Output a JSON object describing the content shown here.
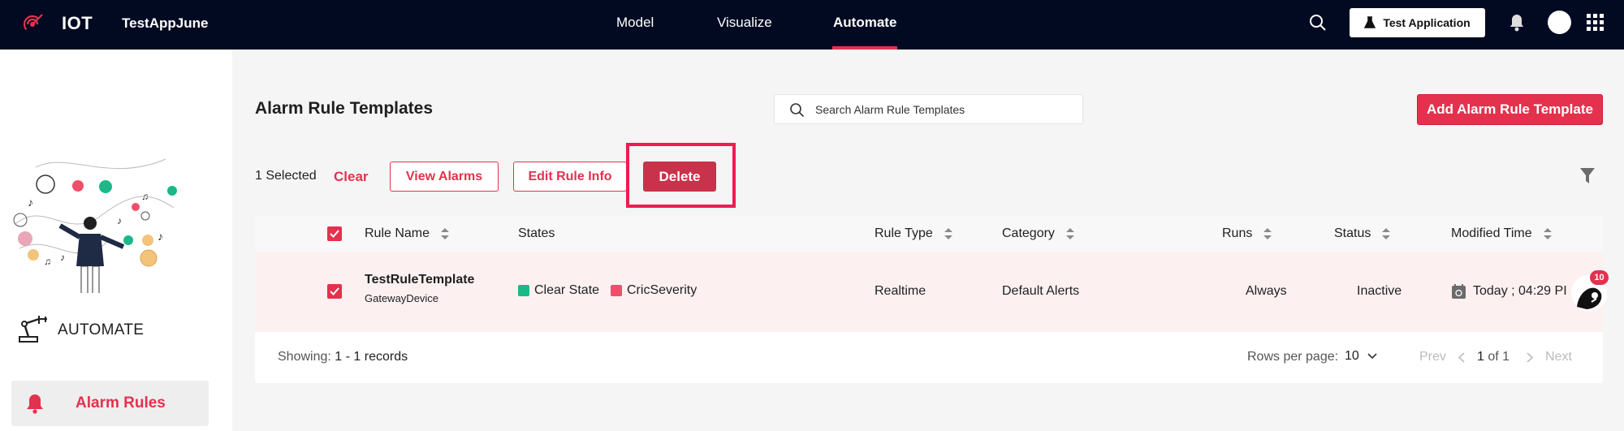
{
  "header": {
    "brand": "IOT",
    "app_name": "TestAppJune",
    "nav": [
      "Model",
      "Visualize",
      "Automate"
    ],
    "active_nav": "Automate",
    "app_button": "Test Application"
  },
  "sidebar": {
    "section_title": "AUTOMATE",
    "items": [
      {
        "label": "Alarm Rules"
      }
    ]
  },
  "main": {
    "title": "Alarm Rule Templates",
    "search_placeholder": "Search Alarm Rule Templates",
    "add_button": "Add Alarm Rule Template",
    "selection_text": "1 Selected",
    "clear_label": "Clear",
    "view_alarms": "View Alarms",
    "edit_rule_info": "Edit Rule Info",
    "delete": "Delete"
  },
  "table": {
    "columns": [
      "Rule Name",
      "States",
      "Rule Type",
      "Category",
      "Runs",
      "Status",
      "Modified Time"
    ],
    "rows": [
      {
        "name": "TestRuleTemplate",
        "sub": "GatewayDevice",
        "states": [
          {
            "label": "Clear State",
            "color": "#1bb889"
          },
          {
            "label": "CricSeverity",
            "color": "#ef4f68"
          }
        ],
        "rule_type": "Realtime",
        "category": "Default Alerts",
        "runs": "Always",
        "status": "Inactive",
        "modified": "Today ; 04:29 PI"
      }
    ]
  },
  "footer": {
    "showing_label": "Showing:",
    "showing_value": "1 - 1 records",
    "rows_per_page_label": "Rows per page:",
    "rows_per_page_value": "10",
    "prev": "Prev",
    "page_current": "1",
    "page_of": "of 1",
    "next": "Next"
  },
  "chat": {
    "badge": "10"
  },
  "colors": {
    "accent": "#e4314d",
    "header_bg": "#020a22",
    "highlight": "#ef1b51"
  }
}
